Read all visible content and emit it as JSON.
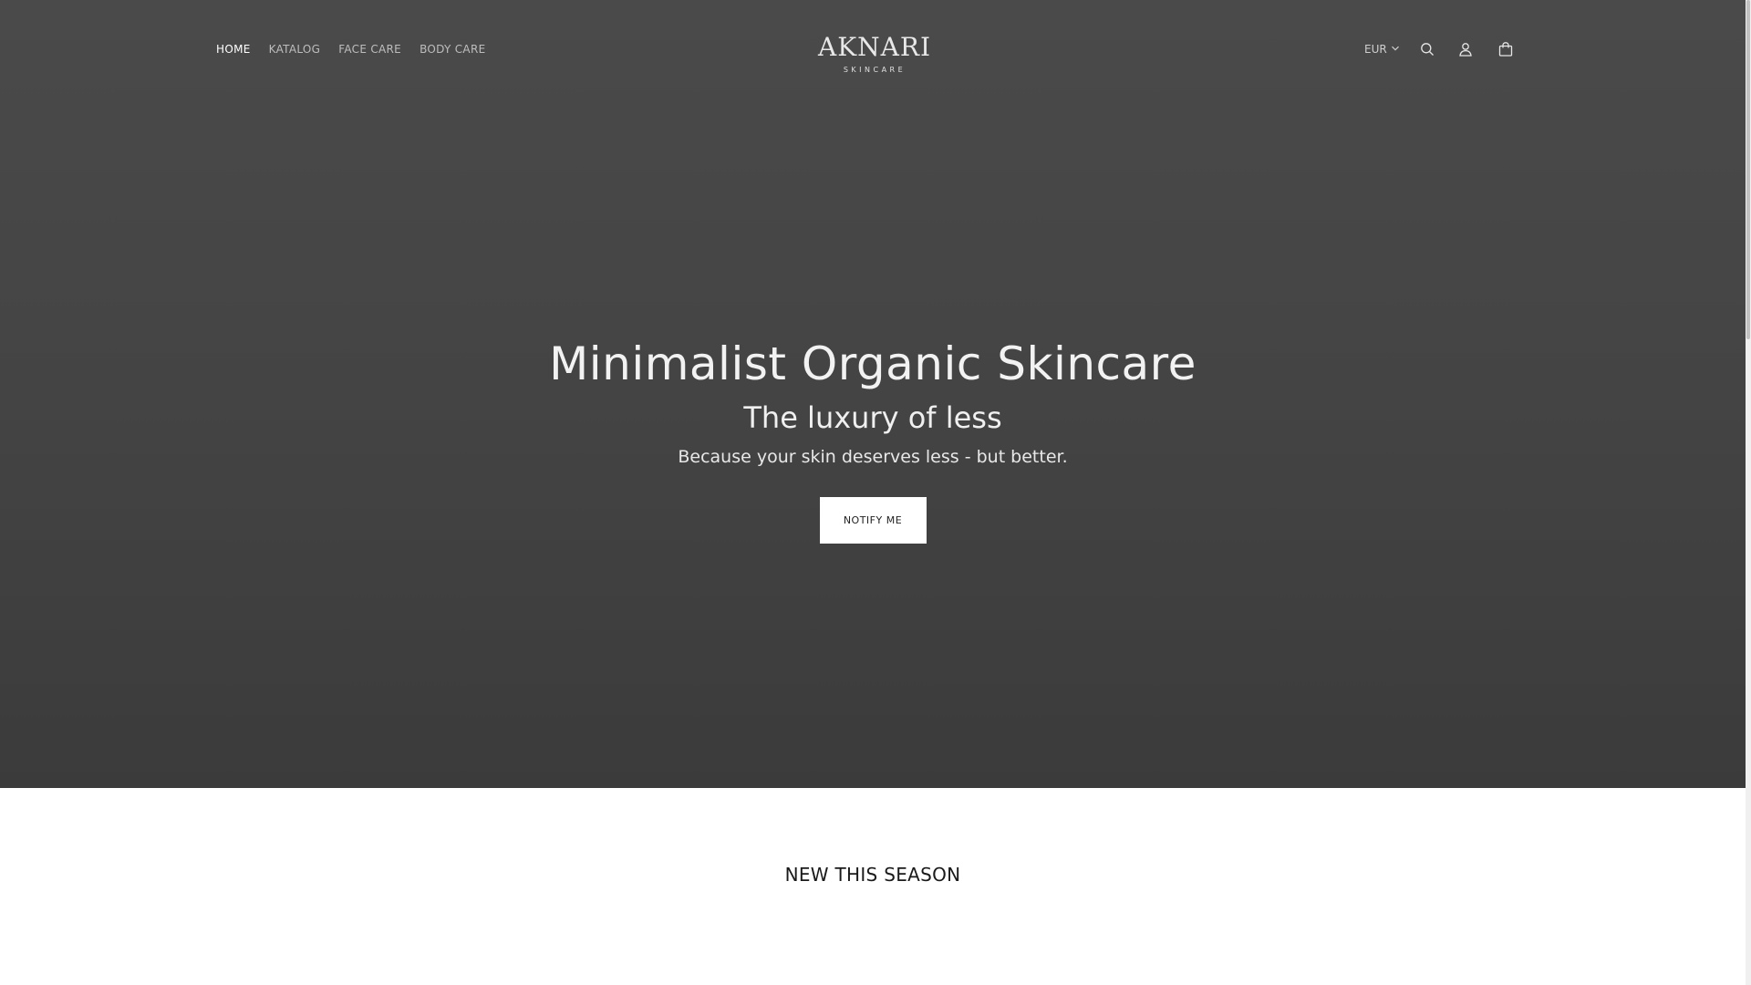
{
  "header": {
    "nav": [
      {
        "label": "HOME",
        "active": true
      },
      {
        "label": "KATALOG",
        "active": false
      },
      {
        "label": "FACE CARE",
        "active": false
      },
      {
        "label": "BODY CARE",
        "active": false
      }
    ],
    "logo": {
      "name": "AKNARI",
      "sub": "SKINCARE"
    },
    "currency": "EUR",
    "icons": [
      "search-icon",
      "account-icon",
      "cart-icon"
    ]
  },
  "hero": {
    "title": "Minimalist Organic Skincare",
    "subtitle": "The luxury of less",
    "text": "Because your skin deserves less - but better.",
    "button_label": "NOTIFY ME"
  },
  "sections": {
    "new_season_title": "NEW THIS SEASON"
  },
  "colors": {
    "hero_bg": "#454545",
    "button_bg": "#ffffff",
    "text_light": "#f2f2f2"
  }
}
